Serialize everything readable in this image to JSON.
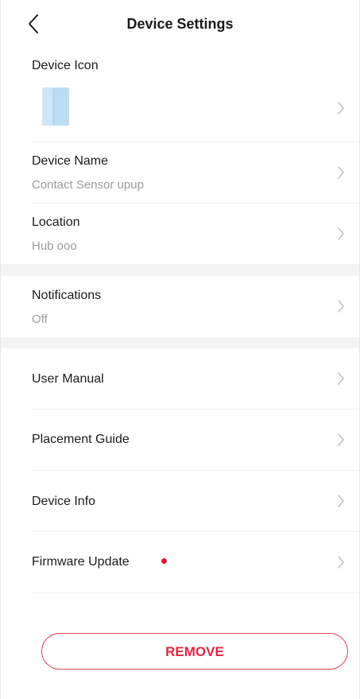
{
  "header": {
    "title": "Device Settings",
    "back_icon": "chevron-left-icon"
  },
  "device_icon_row": {
    "label": "Device Icon",
    "icon": "contact-sensor-icon",
    "icon_color": "#bcdcf4"
  },
  "device_name_row": {
    "label": "Device Name",
    "value": "Contact Sensor upup"
  },
  "location_row": {
    "label": "Location",
    "value": "Hub ooo"
  },
  "notifications_row": {
    "label": "Notifications",
    "value": "Off"
  },
  "menu": {
    "user_manual": "User Manual",
    "placement_guide": "Placement Guide",
    "device_info": "Device Info",
    "firmware_update": "Firmware Update"
  },
  "firmware_update_badge_color": "#e0182f",
  "remove_button": {
    "label": "REMOVE",
    "color": "#e0283f"
  }
}
